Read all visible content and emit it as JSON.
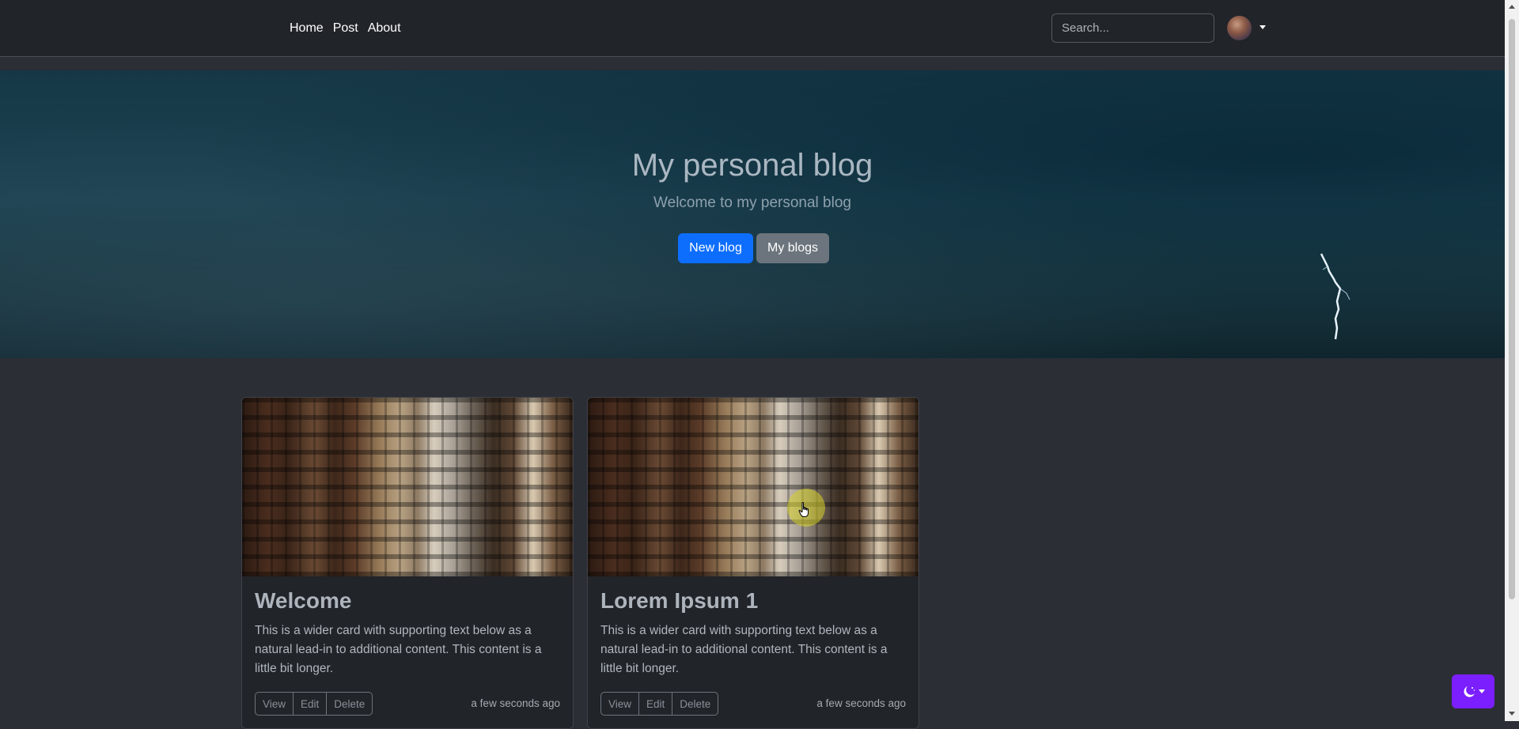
{
  "navbar": {
    "links": [
      "Home",
      "Post",
      "About"
    ],
    "search_placeholder": "Search...",
    "avatar_icon": "user-avatar",
    "caret_icon": "caret-down-icon"
  },
  "hero": {
    "title": "My personal blog",
    "subtitle": "Welcome to my personal blog",
    "primary_button": "New blog",
    "secondary_button": "My blogs"
  },
  "cards": [
    {
      "title": "Welcome",
      "text": "This is a wider card with supporting text below as a natural lead-in to additional content. This content is a little bit longer.",
      "actions": [
        "View",
        "Edit",
        "Delete"
      ],
      "timestamp": "a few seconds ago"
    },
    {
      "title": "Lorem Ipsum 1",
      "text": "This is a wider card with supporting text below as a natural lead-in to additional content. This content is a little bit longer.",
      "actions": [
        "View",
        "Edit",
        "Delete"
      ],
      "timestamp": "a few seconds ago"
    }
  ],
  "theme_toggle": {
    "icon": "moon-stars-icon",
    "accent_color": "#7b1fff"
  },
  "colors": {
    "primary": "#0d6efd",
    "secondary": "#6c757d",
    "navbar_bg": "#212429",
    "page_bg": "#2b2e35"
  }
}
